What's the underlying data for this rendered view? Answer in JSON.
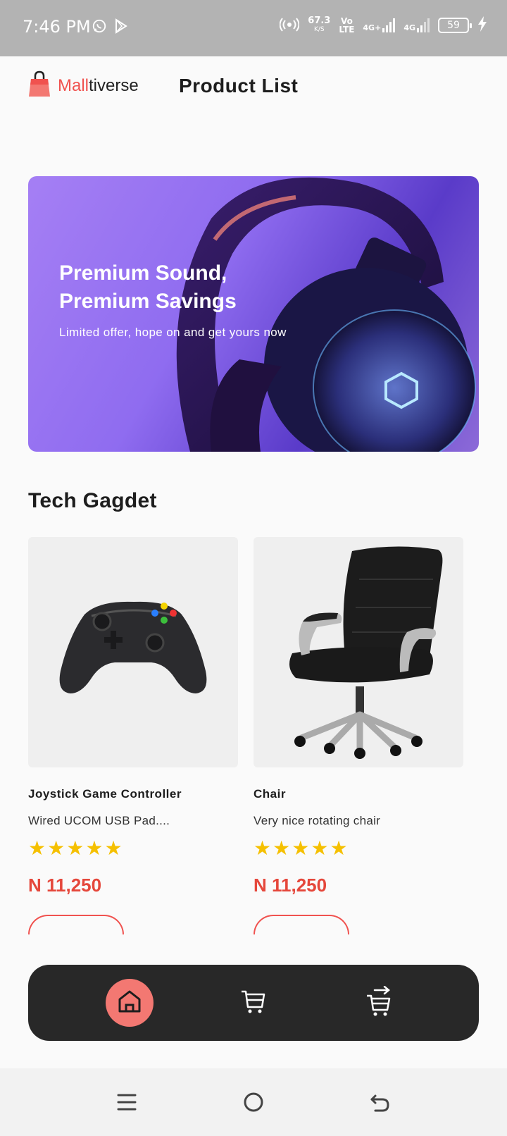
{
  "status_bar": {
    "time": "7:46 PM",
    "net_speed_value": "67.3",
    "net_speed_unit": "K/S",
    "volte_top": "Vo",
    "volte_bottom": "LTE",
    "network_1": "4G+",
    "network_2": "4G",
    "battery": "59"
  },
  "header": {
    "logo_part1": "Mall",
    "logo_part2": "tiverse",
    "title": "Product List"
  },
  "banner": {
    "title_line1": "Premium Sound,",
    "title_line2": "Premium Savings",
    "subtitle": "Limited offer, hope on and get yours now"
  },
  "section": {
    "title": "Tech Gagdet"
  },
  "products": [
    {
      "name": "Joystick Game Controller",
      "description": "Wired UCOM USB Pad....",
      "rating": 5,
      "price": "N 11,250"
    },
    {
      "name": "Chair",
      "description": "Very nice rotating chair",
      "rating": 5,
      "price": "N 11,250"
    }
  ],
  "bottom_nav": {
    "items": [
      "home-icon",
      "cart-icon",
      "orders-icon"
    ],
    "active": "home-icon",
    "active_color": "#f37872"
  },
  "colors": {
    "accent": "#f0524f",
    "price": "#e5473b",
    "star": "#f5c000"
  }
}
